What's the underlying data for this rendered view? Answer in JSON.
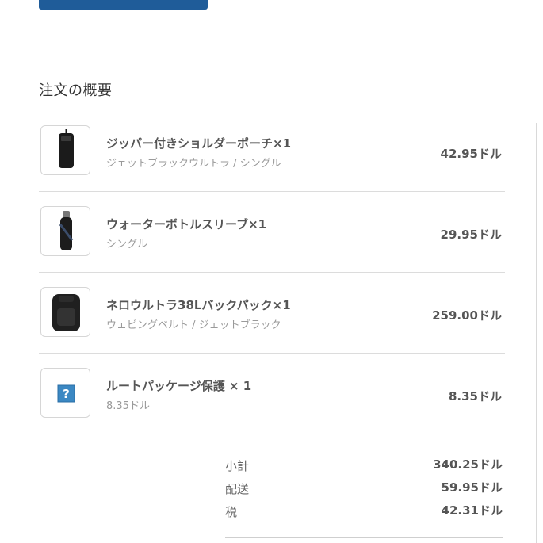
{
  "summary": {
    "title": "注文の概要"
  },
  "items": [
    {
      "name": "ジッパー付きショルダーポーチ×1",
      "variant": "ジェットブラックウルトラ / シングル",
      "price": "42.95ドル",
      "icon": "pouch-image"
    },
    {
      "name": "ウォーターボトルスリーブ×1",
      "variant": "シングル",
      "price": "29.95ドル",
      "icon": "bottle-sleeve-image"
    },
    {
      "name": "ネロウルトラ38Lバックパック×1",
      "variant": "ウェビングベルト / ジェットブラック",
      "price": "259.00ドル",
      "icon": "backpack-image"
    },
    {
      "name": "ルートパッケージ保護 × 1",
      "variant": "8.35ドル",
      "price": "8.35ドル",
      "icon": "question-icon"
    }
  ],
  "totals": [
    {
      "label": "小計",
      "value": "340.25ドル"
    },
    {
      "label": "配送",
      "value": "59.95ドル"
    },
    {
      "label": "税",
      "value": "42.31ドル"
    }
  ],
  "colors": {
    "accent": "#1f5c99",
    "divider": "#dcdcdc"
  }
}
